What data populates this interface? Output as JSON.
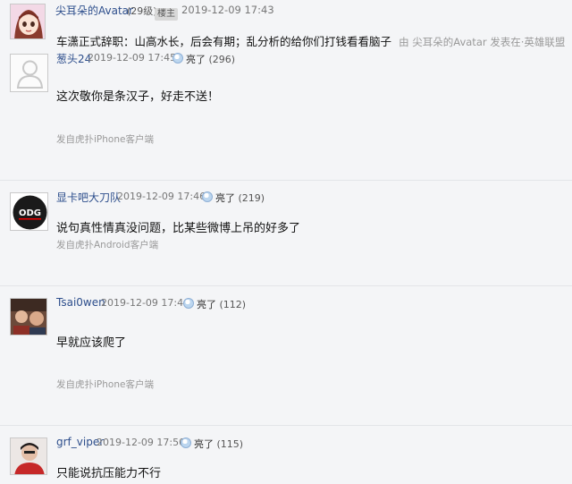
{
  "header": {
    "username": "尖耳朵的Avatar",
    "level": "(29级)",
    "badge": "楼主",
    "time": "2019-12-09 17:43",
    "quote_text": "车潇正式辞职：山高水长，后会有期；乱分析的给你们打钱看看脑子",
    "quote_meta": "由  尖耳朵的Avatar 发表在·英雄联盟"
  },
  "replies": [
    {
      "username": "葱头24",
      "time": "2019-12-09 17:45",
      "light_label": "亮了",
      "light_count": "(296)",
      "content": "这次敬你是条汉子，好走不送！",
      "source": "发自虎扑iPhone客户端"
    },
    {
      "username": "显卡吧大刀队",
      "time": "2019-12-09 17:46",
      "light_label": "亮了",
      "light_count": "(219)",
      "content": "说句真性情真没问题，比某些微博上吊的好多了",
      "source": "发自虎扑Android客户端"
    },
    {
      "username": "Tsai0wen",
      "time": "2019-12-09 17:46",
      "light_label": "亮了",
      "light_count": "(112)",
      "content": "早就应该爬了",
      "source": "发自虎扑iPhone客户端"
    },
    {
      "username": "grf_viper",
      "time": "2019-12-09 17:50",
      "light_label": "亮了",
      "light_count": "(115)",
      "content": "只能说抗压能力不行",
      "source": ""
    }
  ],
  "avatar_logo_text": "ODG",
  "colors": {
    "background": "#f4f5f7",
    "username": "#2d4e8c",
    "meta": "#777777",
    "source": "#999999"
  }
}
